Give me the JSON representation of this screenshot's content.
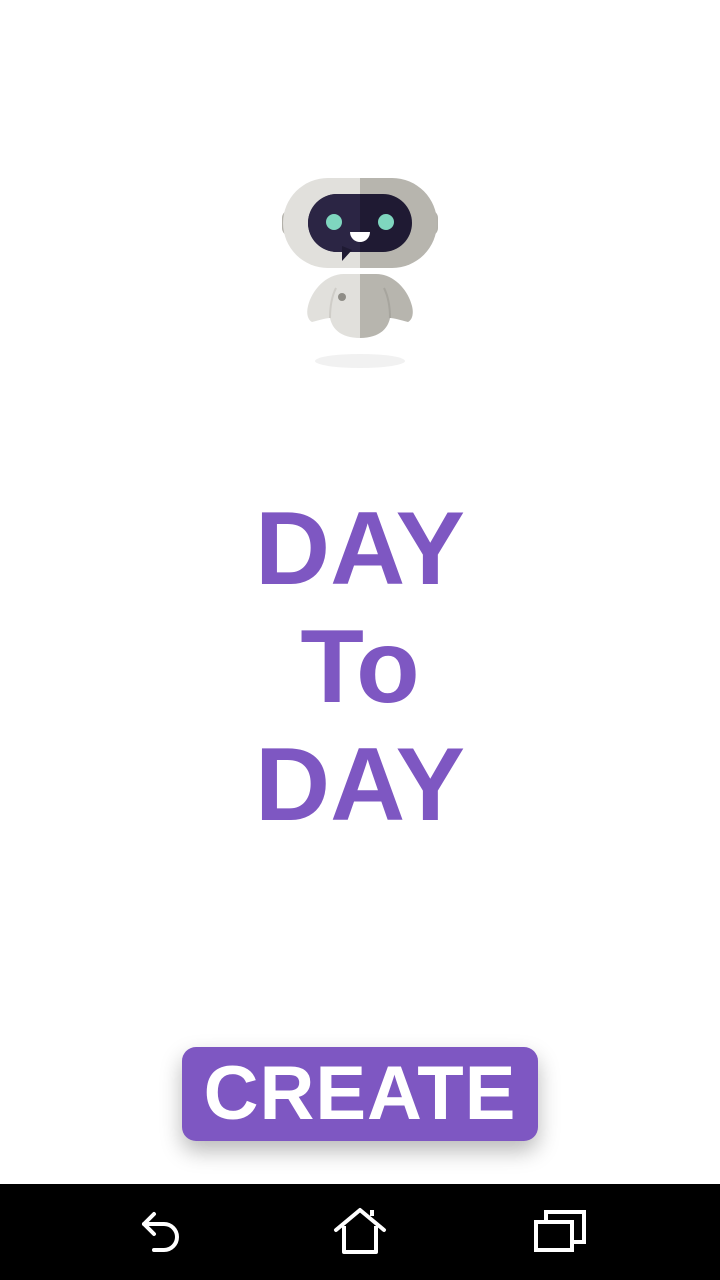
{
  "app": {
    "title_lines": [
      "DAY",
      "To",
      "DAY"
    ],
    "accent_color": "#7e57c2"
  },
  "illustration": {
    "icon": "robot-icon"
  },
  "actions": {
    "create_label": "CREATE"
  },
  "navigation_bar": {
    "back_icon": "back-icon",
    "home_icon": "home-icon",
    "recents_icon": "recents-icon"
  }
}
